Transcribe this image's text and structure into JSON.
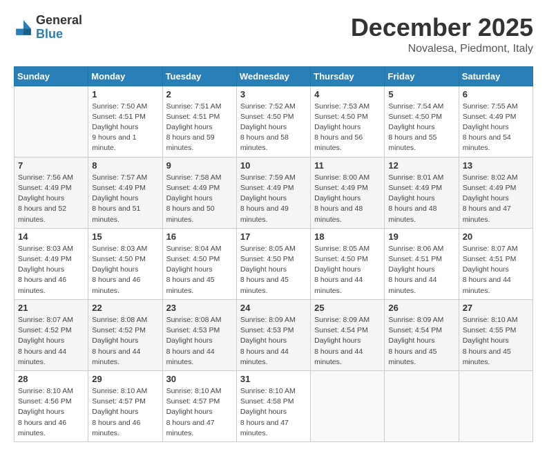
{
  "header": {
    "logo_general": "General",
    "logo_blue": "Blue",
    "month_title": "December 2025",
    "location": "Novalesa, Piedmont, Italy"
  },
  "days_of_week": [
    "Sunday",
    "Monday",
    "Tuesday",
    "Wednesday",
    "Thursday",
    "Friday",
    "Saturday"
  ],
  "weeks": [
    [
      {
        "day": "",
        "empty": true
      },
      {
        "day": "1",
        "sunrise": "7:50 AM",
        "sunset": "4:51 PM",
        "daylight": "9 hours and 1 minute."
      },
      {
        "day": "2",
        "sunrise": "7:51 AM",
        "sunset": "4:51 PM",
        "daylight": "8 hours and 59 minutes."
      },
      {
        "day": "3",
        "sunrise": "7:52 AM",
        "sunset": "4:50 PM",
        "daylight": "8 hours and 58 minutes."
      },
      {
        "day": "4",
        "sunrise": "7:53 AM",
        "sunset": "4:50 PM",
        "daylight": "8 hours and 56 minutes."
      },
      {
        "day": "5",
        "sunrise": "7:54 AM",
        "sunset": "4:50 PM",
        "daylight": "8 hours and 55 minutes."
      },
      {
        "day": "6",
        "sunrise": "7:55 AM",
        "sunset": "4:49 PM",
        "daylight": "8 hours and 54 minutes."
      }
    ],
    [
      {
        "day": "7",
        "sunrise": "7:56 AM",
        "sunset": "4:49 PM",
        "daylight": "8 hours and 52 minutes."
      },
      {
        "day": "8",
        "sunrise": "7:57 AM",
        "sunset": "4:49 PM",
        "daylight": "8 hours and 51 minutes."
      },
      {
        "day": "9",
        "sunrise": "7:58 AM",
        "sunset": "4:49 PM",
        "daylight": "8 hours and 50 minutes."
      },
      {
        "day": "10",
        "sunrise": "7:59 AM",
        "sunset": "4:49 PM",
        "daylight": "8 hours and 49 minutes."
      },
      {
        "day": "11",
        "sunrise": "8:00 AM",
        "sunset": "4:49 PM",
        "daylight": "8 hours and 48 minutes."
      },
      {
        "day": "12",
        "sunrise": "8:01 AM",
        "sunset": "4:49 PM",
        "daylight": "8 hours and 48 minutes."
      },
      {
        "day": "13",
        "sunrise": "8:02 AM",
        "sunset": "4:49 PM",
        "daylight": "8 hours and 47 minutes."
      }
    ],
    [
      {
        "day": "14",
        "sunrise": "8:03 AM",
        "sunset": "4:49 PM",
        "daylight": "8 hours and 46 minutes."
      },
      {
        "day": "15",
        "sunrise": "8:03 AM",
        "sunset": "4:50 PM",
        "daylight": "8 hours and 46 minutes."
      },
      {
        "day": "16",
        "sunrise": "8:04 AM",
        "sunset": "4:50 PM",
        "daylight": "8 hours and 45 minutes."
      },
      {
        "day": "17",
        "sunrise": "8:05 AM",
        "sunset": "4:50 PM",
        "daylight": "8 hours and 45 minutes."
      },
      {
        "day": "18",
        "sunrise": "8:05 AM",
        "sunset": "4:50 PM",
        "daylight": "8 hours and 44 minutes."
      },
      {
        "day": "19",
        "sunrise": "8:06 AM",
        "sunset": "4:51 PM",
        "daylight": "8 hours and 44 minutes."
      },
      {
        "day": "20",
        "sunrise": "8:07 AM",
        "sunset": "4:51 PM",
        "daylight": "8 hours and 44 minutes."
      }
    ],
    [
      {
        "day": "21",
        "sunrise": "8:07 AM",
        "sunset": "4:52 PM",
        "daylight": "8 hours and 44 minutes."
      },
      {
        "day": "22",
        "sunrise": "8:08 AM",
        "sunset": "4:52 PM",
        "daylight": "8 hours and 44 minutes."
      },
      {
        "day": "23",
        "sunrise": "8:08 AM",
        "sunset": "4:53 PM",
        "daylight": "8 hours and 44 minutes."
      },
      {
        "day": "24",
        "sunrise": "8:09 AM",
        "sunset": "4:53 PM",
        "daylight": "8 hours and 44 minutes."
      },
      {
        "day": "25",
        "sunrise": "8:09 AM",
        "sunset": "4:54 PM",
        "daylight": "8 hours and 44 minutes."
      },
      {
        "day": "26",
        "sunrise": "8:09 AM",
        "sunset": "4:54 PM",
        "daylight": "8 hours and 45 minutes."
      },
      {
        "day": "27",
        "sunrise": "8:10 AM",
        "sunset": "4:55 PM",
        "daylight": "8 hours and 45 minutes."
      }
    ],
    [
      {
        "day": "28",
        "sunrise": "8:10 AM",
        "sunset": "4:56 PM",
        "daylight": "8 hours and 46 minutes."
      },
      {
        "day": "29",
        "sunrise": "8:10 AM",
        "sunset": "4:57 PM",
        "daylight": "8 hours and 46 minutes."
      },
      {
        "day": "30",
        "sunrise": "8:10 AM",
        "sunset": "4:57 PM",
        "daylight": "8 hours and 47 minutes."
      },
      {
        "day": "31",
        "sunrise": "8:10 AM",
        "sunset": "4:58 PM",
        "daylight": "8 hours and 47 minutes."
      },
      {
        "day": "",
        "empty": true
      },
      {
        "day": "",
        "empty": true
      },
      {
        "day": "",
        "empty": true
      }
    ]
  ]
}
